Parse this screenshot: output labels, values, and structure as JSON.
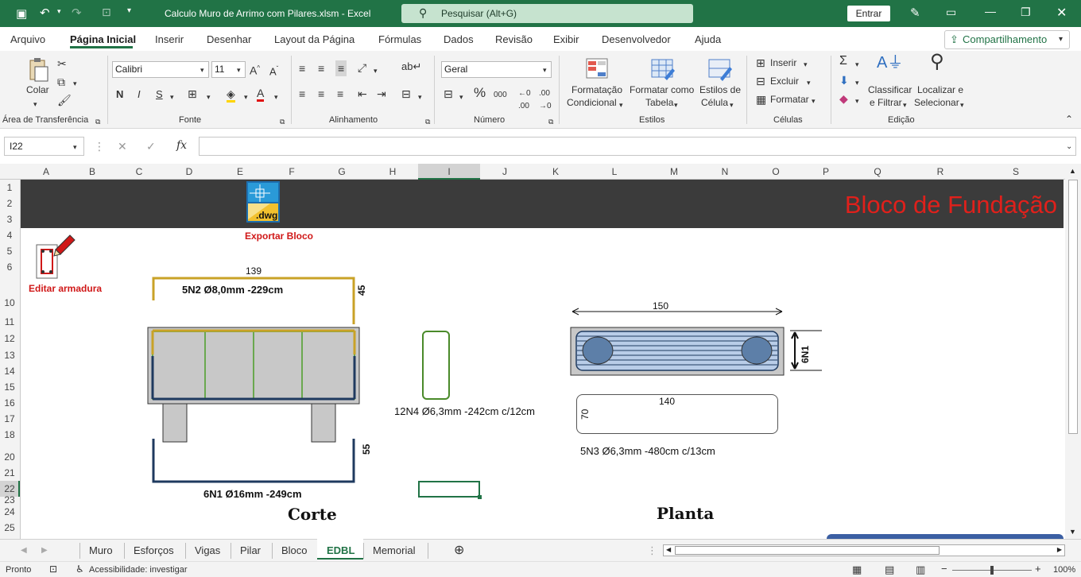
{
  "titlebar": {
    "doc_title": "Calculo Muro de Arrimo com  Pilares.xlsm  -  Excel",
    "search_placeholder": "Pesquisar (Alt+G)",
    "signin": "Entrar"
  },
  "menu": {
    "items": [
      "Arquivo",
      "Página Inicial",
      "Inserir",
      "Desenhar",
      "Layout da Página",
      "Fórmulas",
      "Dados",
      "Revisão",
      "Exibir",
      "Desenvolvedor",
      "Ajuda"
    ],
    "share": "Compartilhamento"
  },
  "ribbon": {
    "clipboard": {
      "paste": "Colar",
      "group": "Área de Transferência"
    },
    "font": {
      "name": "Calibri",
      "size": "11",
      "bold": "N",
      "italic": "I",
      "underline": "S",
      "group": "Fonte"
    },
    "alignment": {
      "group": "Alinhamento"
    },
    "number": {
      "format": "Geral",
      "percent": "%",
      "thousands": "000",
      "group": "Número"
    },
    "styles": {
      "cond_format": [
        "Formatação",
        "Condicional"
      ],
      "as_table": [
        "Formatar como",
        "Tabela"
      ],
      "cell_styles": [
        "Estilos de",
        "Célula"
      ],
      "group": "Estilos"
    },
    "cells": {
      "insert": "Inserir",
      "delete": "Excluir",
      "format": "Formatar",
      "group": "Células"
    },
    "editing": {
      "sort": [
        "Classificar",
        "e Filtrar"
      ],
      "find": [
        "Localizar e",
        "Selecionar"
      ],
      "group": "Edição"
    }
  },
  "formula_bar": {
    "name_box": "I22",
    "fx": "fx",
    "value": ""
  },
  "columns": [
    "A",
    "B",
    "C",
    "D",
    "E",
    "F",
    "G",
    "H",
    "I",
    "J",
    "K",
    "L",
    "M",
    "N",
    "O",
    "P",
    "Q",
    "R",
    "S"
  ],
  "rows": [
    "1",
    "2",
    "3",
    "4",
    "5",
    "6",
    "10",
    "11",
    "12",
    "13",
    "14",
    "15",
    "16",
    "17",
    "18",
    "20",
    "21",
    "22",
    "23",
    "24",
    "25"
  ],
  "sheet": {
    "banner_title": "Bloco de Fundação",
    "export_caption": "Exportar Bloco",
    "export_icon_text": ".dwg",
    "edit_caption": "Editar armadura",
    "corte": {
      "top_width": "139",
      "top_bar": "5N2 Ø8,0mm -229cm",
      "top_height": "45",
      "bottom_height": "55",
      "bottom_bar": "6N1 Ø16mm -249cm",
      "title": "Corte"
    },
    "stirrup": {
      "label": "12N4 Ø6,3mm -242cm c/12cm"
    },
    "planta": {
      "width": "150",
      "side": "6N1",
      "ring_width": "140",
      "ring_height": "70",
      "ring_bar": "5N3 Ø6,3mm -480cm c/13cm",
      "title": "Planta"
    }
  },
  "tabs": [
    "Muro",
    "Esforços",
    "Vigas",
    "Pilar",
    "Bloco",
    "EDBL",
    "Memorial"
  ],
  "active_tab": "EDBL",
  "status": {
    "ready": "Pronto",
    "accessibility": "Acessibilidade: investigar",
    "zoom": "100%"
  },
  "colors": {
    "excel_green": "#217346",
    "banner": "#3b3b3b",
    "banner_title": "#e0201b",
    "bar_top": "#c9a227",
    "bar_bottom": "#1f3a5f",
    "stirrup": "#4a8a2a"
  }
}
